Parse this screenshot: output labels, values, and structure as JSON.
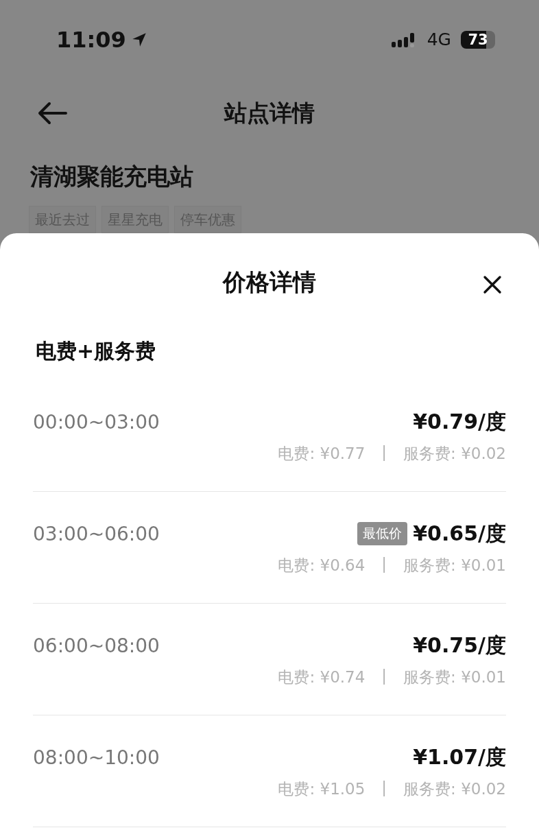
{
  "status_bar": {
    "time": "11:09",
    "network": "4G",
    "battery": "73"
  },
  "nav": {
    "title": "站点详情"
  },
  "station": {
    "name": "清湖聚能充电站",
    "tags": [
      "最近去过",
      "星星充电",
      "停车优惠"
    ]
  },
  "sheet": {
    "title": "价格详情",
    "section": "电费+服务费",
    "rows": [
      {
        "time": "00:00~03:00",
        "price": "¥0.79/度",
        "electricity": "电费: ¥0.77",
        "separator": "|",
        "service": "服务费: ¥0.02"
      },
      {
        "time": "03:00~06:00",
        "badge": "最低价",
        "price": "¥0.65/度",
        "electricity": "电费: ¥0.64",
        "separator": "|",
        "service": "服务费: ¥0.01"
      },
      {
        "time": "06:00~08:00",
        "price": "¥0.75/度",
        "electricity": "电费: ¥0.74",
        "separator": "|",
        "service": "服务费: ¥0.01"
      },
      {
        "time": "08:00~10:00",
        "price": "¥1.07/度",
        "electricity": "电费: ¥1.05",
        "separator": "|",
        "service": "服务费: ¥0.02"
      }
    ]
  }
}
